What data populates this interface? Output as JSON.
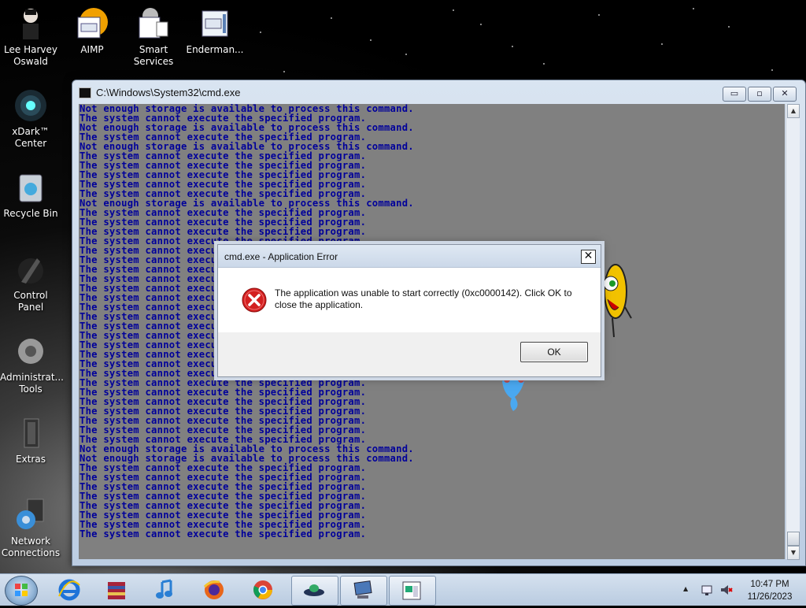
{
  "desktop": {
    "icons": [
      {
        "label": "Lee Harvey Oswald",
        "icon": "person-icon"
      },
      {
        "label": "AIMP",
        "icon": "aimp-icon"
      },
      {
        "label": "Smart Services",
        "icon": "services-icon"
      },
      {
        "label": "Enderman...",
        "icon": "window-app-icon"
      },
      {
        "label": "xDark™ Center",
        "icon": "xdark-icon"
      },
      {
        "label": "Recycle Bin",
        "icon": "recycle-bin-icon"
      },
      {
        "label": "Control Panel",
        "icon": "control-panel-icon"
      },
      {
        "label": "Administrat... Tools",
        "icon": "admin-tools-icon"
      },
      {
        "label": "Extras",
        "icon": "extras-icon"
      },
      {
        "label": "Network Connections",
        "icon": "network-icon"
      }
    ]
  },
  "cmd_window": {
    "title": "C:\\Windows\\System32\\cmd.exe",
    "minimize": "▭",
    "restore": "▫",
    "close": "✕",
    "lines": [
      "Not enough storage is available to process this command.",
      "The system cannot execute the specified program.",
      "Not enough storage is available to process this command.",
      "The system cannot execute the specified program.",
      "Not enough storage is available to process this command.",
      "The system cannot execute the specified program.",
      "The system cannot execute the specified program.",
      "The system cannot execute the specified program.",
      "The system cannot execute the specified program.",
      "The system cannot execute the specified program.",
      "Not enough storage is available to process this command.",
      "The system cannot execute the specified program.",
      "The system cannot execute the specified program.",
      "The system cannot execute the specified program.",
      "The system cannot execute the specified program.",
      "The system cannot execute the specified program.",
      "The system cannot execute the specified program.",
      "The system cannot execute the specified program.",
      "The system cannot execute the specified program.",
      "The system cannot execute the specified program.",
      "The system cannot execute the specified program.",
      "The system cannot execute the specified program.",
      "The system cannot execute the specified program.",
      "The system cannot execute the specified program.",
      "The system cannot execute the specified program.",
      "The system cannot execute the specified program.",
      "The system cannot execute the specified program.",
      "The system cannot execute the specified program.",
      "The system cannot execute the specified program.",
      "The system cannot execute the specified program.",
      "The system cannot execute the specified program.",
      "The system cannot execute the specified program.",
      "The system cannot execute the specified program.",
      "The system cannot execute the specified program.",
      "The system cannot execute the specified program.",
      "The system cannot execute the specified program.",
      "Not enough storage is available to process this command.",
      "Not enough storage is available to process this command.",
      "The system cannot execute the specified program.",
      "The system cannot execute the specified program.",
      "The system cannot execute the specified program.",
      "The system cannot execute the specified program.",
      "The system cannot execute the specified program.",
      "The system cannot execute the specified program.",
      "The system cannot execute the specified program.",
      "The system cannot execute the specified program."
    ]
  },
  "dialog": {
    "title": "cmd.exe - Application Error",
    "message": "The application was unable to start correctly (0xc0000142). Click OK to close the application.",
    "ok_label": "OK",
    "close_glyph": "✕"
  },
  "taskbar": {
    "items": [
      {
        "name": "internet-explorer-icon",
        "active": false
      },
      {
        "name": "winrar-icon",
        "active": false
      },
      {
        "name": "music-note-icon",
        "active": false
      },
      {
        "name": "firefox-icon",
        "active": false
      },
      {
        "name": "chrome-icon",
        "active": false
      },
      {
        "name": "ufo-app-icon",
        "active": true
      },
      {
        "name": "computer-app-icon",
        "active": true
      },
      {
        "name": "document-window-icon",
        "active": true
      }
    ],
    "tray_arrow": "▲",
    "time": "10:47 PM",
    "date": "11/26/2023"
  }
}
